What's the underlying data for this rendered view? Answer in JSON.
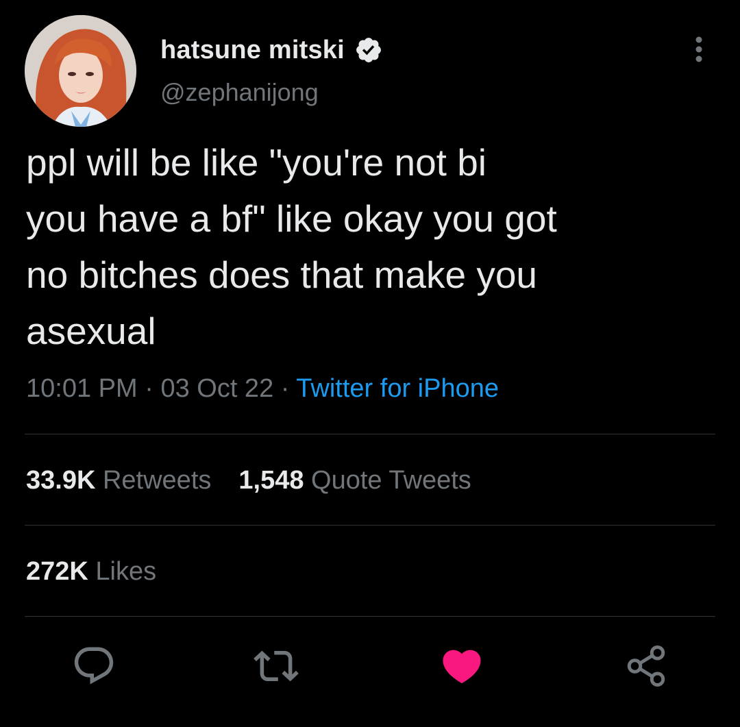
{
  "user": {
    "display_name": "hatsune mitski",
    "handle": "@zephanijong",
    "verified": true
  },
  "tweet": {
    "lines": [
      "ppl will be like \"you're not bi",
      "you have a bf\" like okay you got",
      "no bitches does that make you",
      "asexual"
    ]
  },
  "meta": {
    "time": "10:01 PM",
    "separator": "·",
    "date": "03 Oct 22",
    "source": "Twitter for iPhone"
  },
  "stats": {
    "retweets_count": "33.9K",
    "retweets_label": "Retweets",
    "quotes_count": "1,548",
    "quotes_label": "Quote Tweets",
    "likes_count": "272K",
    "likes_label": "Likes"
  },
  "icons": {
    "reply": "reply-icon",
    "retweet": "retweet-icon",
    "like": "heart-icon",
    "share": "share-icon",
    "more": "more-dots-icon",
    "verified": "verified-badge-icon"
  },
  "colors": {
    "background": "#000000",
    "text": "#e7e9ea",
    "secondary": "#71767b",
    "link": "#1d9bf0",
    "like": "#f91880",
    "divider": "#2f3336"
  }
}
